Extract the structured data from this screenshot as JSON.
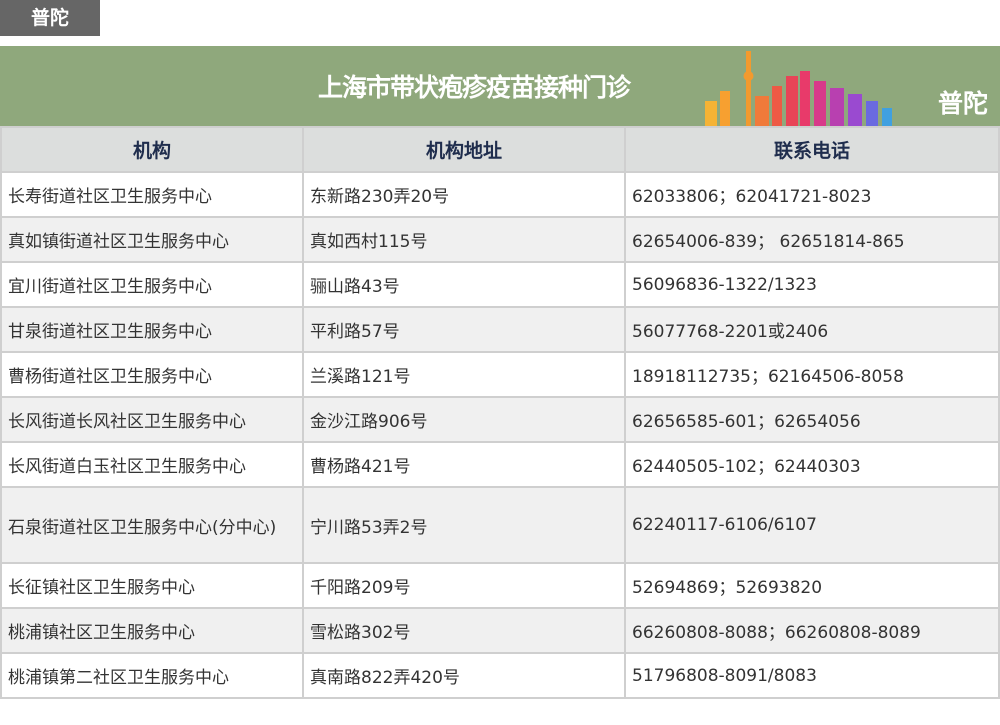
{
  "tag": "普陀",
  "banner": {
    "title": "上海市带状疱疹疫苗接种门诊",
    "district": "普陀"
  },
  "headers": [
    "机构",
    "机构地址",
    "联系电话"
  ],
  "rows": [
    [
      "长寿街道社区卫生服务中心",
      "东新路230弄20号",
      "62033806；62041721-8023"
    ],
    [
      "真如镇街道社区卫生服务中心",
      "真如西村115号",
      "62654006-839； 62651814-865"
    ],
    [
      "宜川街道社区卫生服务中心",
      "骊山路43号",
      "56096836-1322/1323"
    ],
    [
      "甘泉街道社区卫生服务中心",
      "平利路57号",
      "56077768-2201或2406"
    ],
    [
      "曹杨街道社区卫生服务中心",
      "兰溪路121号",
      "18918112735；62164506-8058"
    ],
    [
      "长风街道长风社区卫生服务中心",
      "金沙江路906号",
      "62656585-601；62654056"
    ],
    [
      "长风街道白玉社区卫生服务中心",
      "曹杨路421号",
      "62440505-102；62440303"
    ],
    [
      "石泉街道社区卫生服务中心(分中心)",
      "宁川路53弄2号",
      "62240117-6106/6107"
    ],
    [
      "长征镇社区卫生服务中心",
      "千阳路209号",
      "52694869；52693820"
    ],
    [
      "桃浦镇社区卫生服务中心",
      "雪松路302号",
      "66260808-8088；66260808-8089"
    ],
    [
      "桃浦镇第二社区卫生服务中心",
      "真南路822弄420号",
      "51796808-8091/8083"
    ]
  ]
}
